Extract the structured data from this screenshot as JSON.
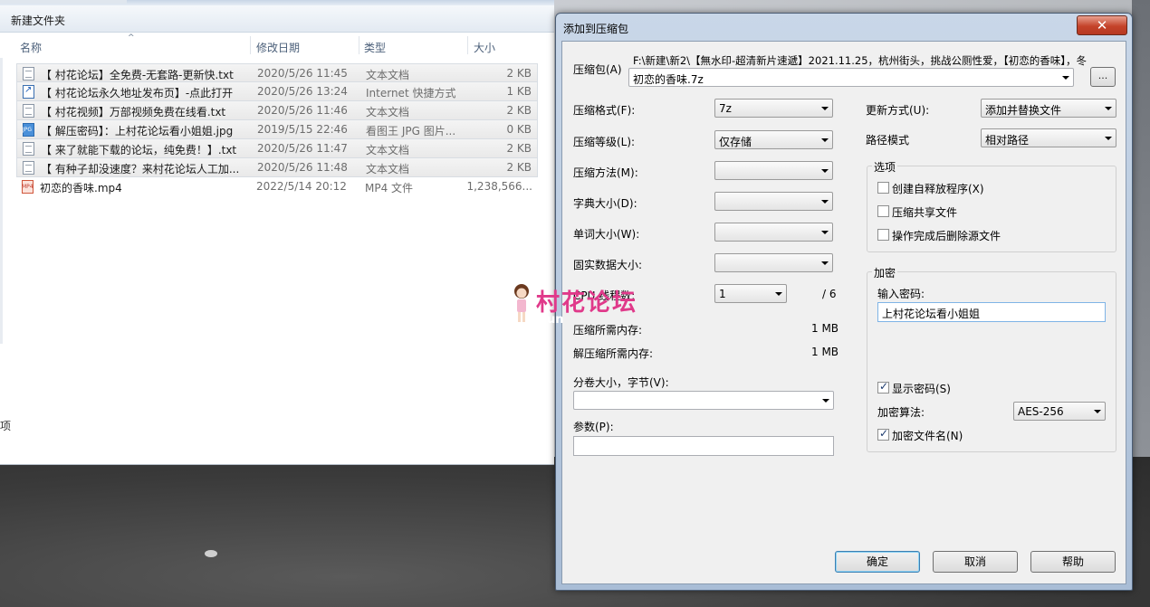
{
  "explorer": {
    "folder_title": "新建文件夹",
    "columns": [
      "名称",
      "修改日期",
      "类型",
      "大小"
    ],
    "files": [
      {
        "icon": "text-file-icon",
        "name": "【 村花论坛】全免费-无套路-更新快.txt",
        "date": "2020/5/26 11:45",
        "type": "文本文档",
        "size": "2 KB"
      },
      {
        "icon": "internet-shortcut-icon",
        "name": "【 村花论坛永久地址发布页】-点此打开",
        "date": "2020/5/26 13:24",
        "type": "Internet 快捷方式",
        "size": "1 KB"
      },
      {
        "icon": "text-file-icon",
        "name": "【 村花视频】万部视频免费在线看.txt",
        "date": "2020/5/26 11:46",
        "type": "文本文档",
        "size": "2 KB"
      },
      {
        "icon": "jpg-file-icon",
        "name": "【 解压密码】：上村花论坛看小姐姐.jpg",
        "date": "2019/5/15 22:46",
        "type": "看图王 JPG 图片...",
        "size": "0 KB"
      },
      {
        "icon": "text-file-icon",
        "name": "【 来了就能下载的论坛，纯免费！】.txt",
        "date": "2020/5/26 11:47",
        "type": "文本文档",
        "size": "2 KB"
      },
      {
        "icon": "text-file-icon",
        "name": "【 有种子却没速度？来村花论坛人工加...",
        "date": "2020/5/26 11:48",
        "type": "文本文档",
        "size": "2 KB"
      },
      {
        "icon": "mp4-file-icon",
        "name": "初恋的香味.mp4",
        "date": "2022/5/14 20:12",
        "type": "MP4 文件",
        "size": "1,238,566..."
      }
    ],
    "status_text": "项"
  },
  "dialog": {
    "title": "添加到压缩包",
    "close_label": "✕",
    "archive_label": "压缩包(A)",
    "archive_path_line1": "F:\\新建\\新2\\【無水印-超清新片速遞】2021.11.25，杭州街头，挑战公厕性爱，【初恋的香味】，冬",
    "archive_path_value": "初恋的香味.7z",
    "browse_label": "...",
    "format_label": "压缩格式(F):",
    "format_value": "7z",
    "level_label": "压缩等级(L):",
    "level_value": "仅存储",
    "method_label": "压缩方法(M):",
    "dict_label": "字典大小(D):",
    "word_label": "单词大小(W):",
    "solid_label": "固实数据大小:",
    "threads_label": "CPU 线程数:",
    "threads_value": "1",
    "threads_total": "/ 6",
    "mem_comp_label": "压缩所需内存:",
    "mem_comp_value": "1 MB",
    "mem_decomp_label": "解压缩所需内存:",
    "mem_decomp_value": "1 MB",
    "volume_label": "分卷大小，字节(V):",
    "params_label": "参数(P):",
    "update_label": "更新方式(U):",
    "update_value": "添加并替换文件",
    "path_mode_label": "路径模式",
    "path_mode_value": "相对路径",
    "options_title": "选项",
    "opt_sfx": "创建自释放程序(X)",
    "opt_shared": "压缩共享文件",
    "opt_delete": "操作完成后删除源文件",
    "encrypt_title": "加密",
    "password_label": "输入密码:",
    "password_value": "上村花论坛看小姐姐",
    "show_password": "显示密码(S)",
    "enc_method_label": "加密算法:",
    "enc_method_value": "AES-256",
    "encrypt_names": "加密文件名(N)",
    "ok_label": "确定",
    "cancel_label": "取消",
    "help_label": "帮助"
  },
  "watermark": {
    "text": "村花论坛",
    "suffix": "un"
  }
}
